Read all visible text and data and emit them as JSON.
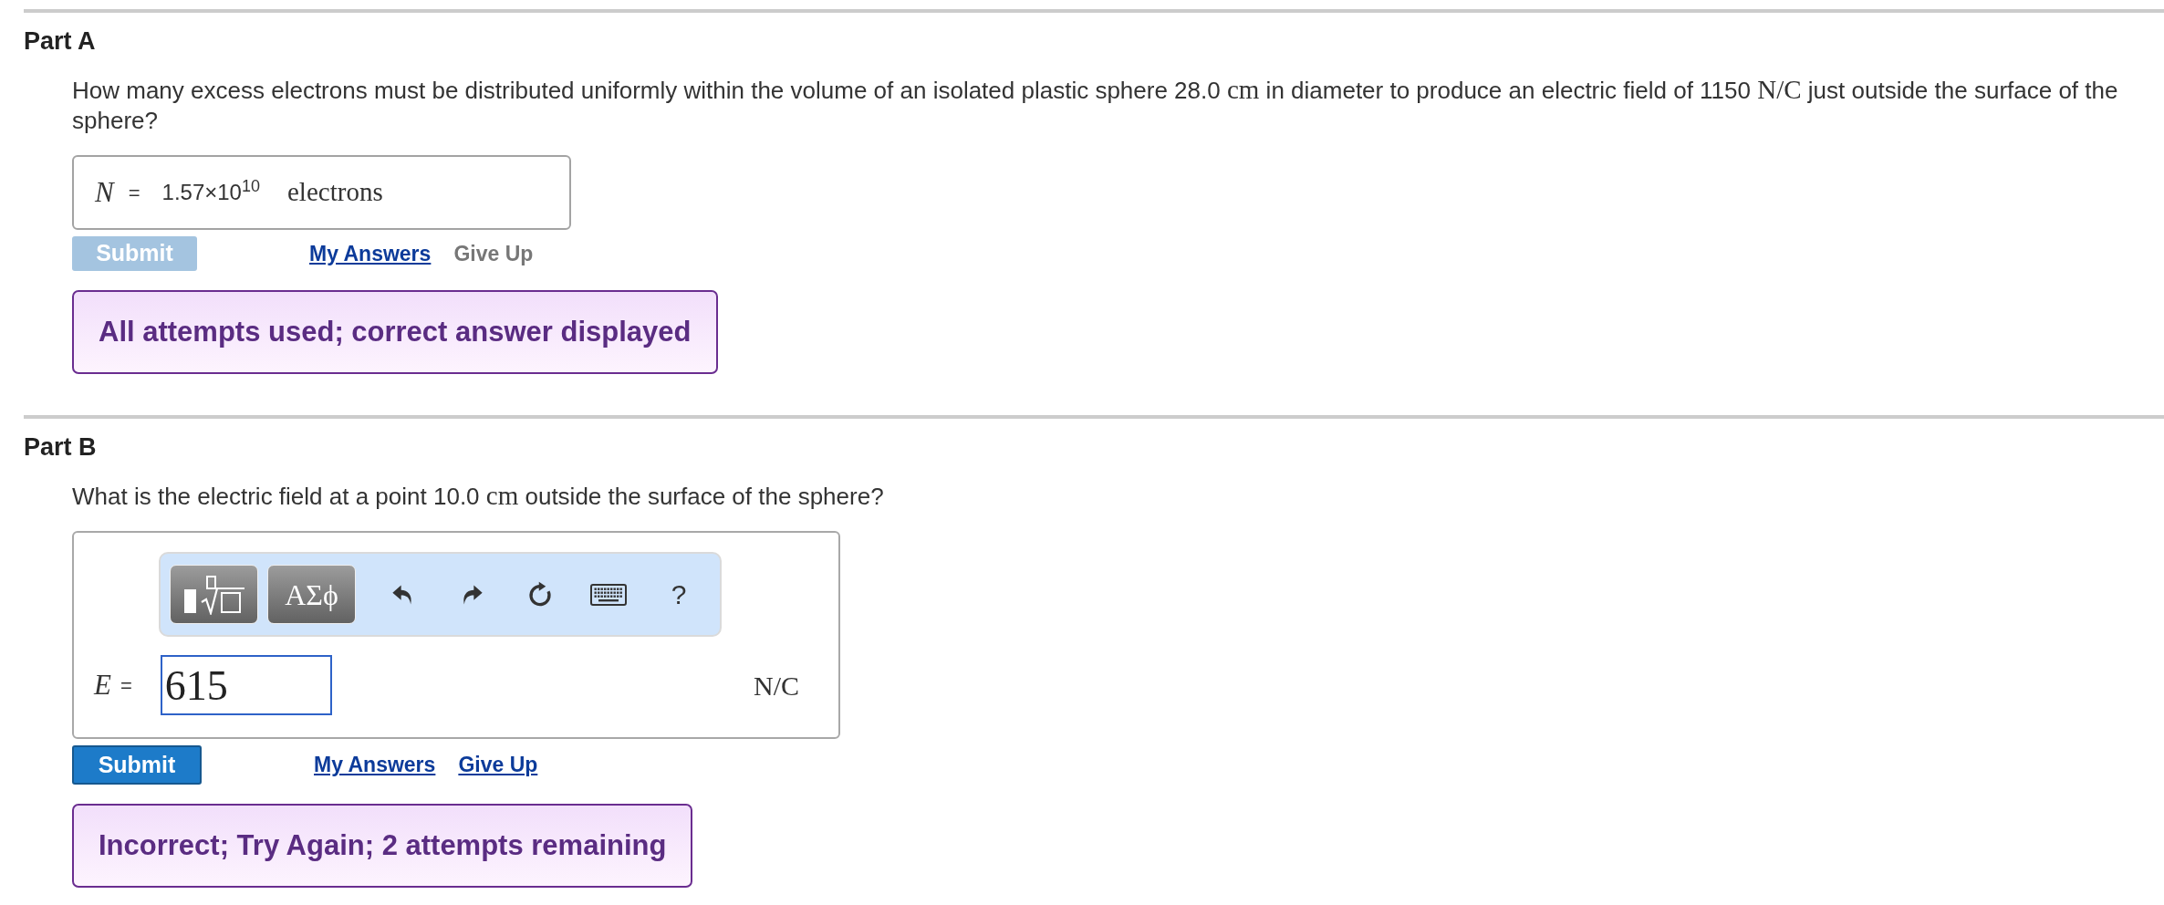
{
  "parts": [
    {
      "title": "Part A",
      "question": [
        {
          "kind": "text",
          "text": "How many excess electrons must be distributed uniformly within the volume of an isolated plastic sphere 28.0 "
        },
        {
          "kind": "math",
          "text": "cm"
        },
        {
          "kind": "text",
          "text": " in diameter to produce an electric field of 1150 "
        },
        {
          "kind": "math",
          "text": "N/C"
        },
        {
          "kind": "text",
          "text": " just outside the surface of the sphere?"
        }
      ],
      "answer": {
        "kind": "display",
        "variable": "N",
        "relation": "=",
        "value": "1.57×10$^{10}$",
        "unit": "electrons"
      },
      "submit": {
        "label": "Submit",
        "disabled": true
      },
      "links": [
        {
          "label": "My Answers",
          "disabled": false
        },
        {
          "label": "Give Up",
          "disabled": true
        }
      ],
      "feedback": "All attempts used; correct answer displayed"
    },
    {
      "title": "Part B",
      "question": [
        {
          "kind": "text",
          "text": "What is the electric field at a point 10.0 "
        },
        {
          "kind": "math",
          "text": "cm"
        },
        {
          "kind": "text",
          "text": " outside the surface of the sphere?"
        }
      ],
      "answer": {
        "kind": "editor",
        "toolbar": [
          {
            "kind": "templates"
          },
          {
            "kind": "symbols",
            "label": "ΑΣϕ"
          },
          {
            "kind": "undo"
          },
          {
            "kind": "redo"
          },
          {
            "kind": "reset"
          },
          {
            "kind": "keyboard"
          },
          {
            "kind": "help",
            "label": "?"
          }
        ],
        "variable": "E",
        "relation": "=",
        "value": "615",
        "unit": "N/C"
      },
      "submit": {
        "label": "Submit",
        "disabled": false
      },
      "links": [
        {
          "label": "My Answers",
          "disabled": false
        },
        {
          "label": "Give Up",
          "disabled": false
        }
      ],
      "feedback": "Incorrect; Try Again; 2 attempts remaining"
    }
  ]
}
